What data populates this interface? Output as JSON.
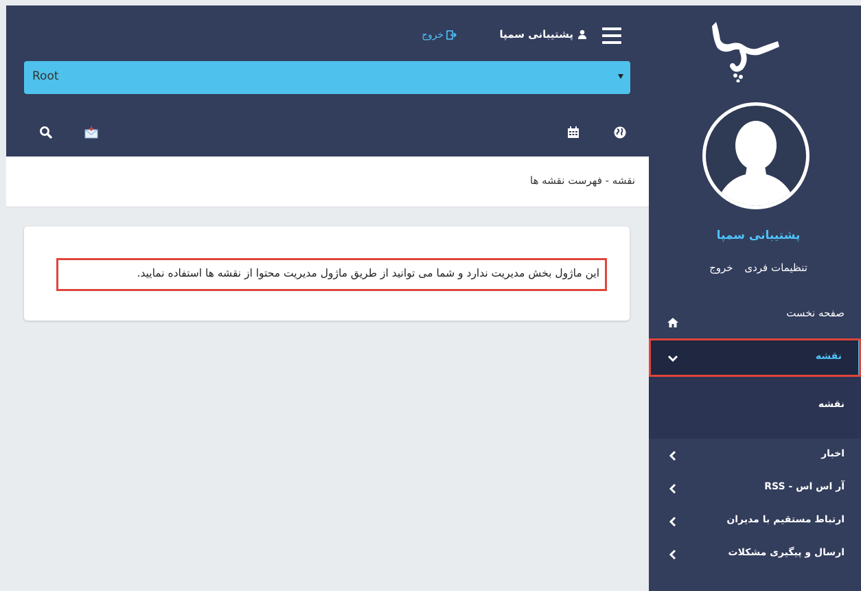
{
  "topbar": {
    "user_name": "پشتیبانی سمپا",
    "logout_label": "خروج",
    "root_select_value": "Root"
  },
  "breadcrumb": {
    "text": "نقشه - فهرست نقشه ها"
  },
  "content": {
    "notice_text": "این ماژول بخش مدیریت ندارد و شما می توانید از طریق ماژول مدیریت محتوا از نقشه ها استفاده نمایید."
  },
  "sidebar": {
    "user_name": "پشتیبانی سمپا",
    "settings_label": "تنظیمات فردی",
    "logout_label": "خروج",
    "menu": {
      "home": "صفحه نخست",
      "map": "نقشه",
      "map_sub": "نقشه",
      "news": "اخبار",
      "rss": "آر اس اس - RSS",
      "managers": "ارتباط مستقیم با مدیران",
      "issues": "ارسال و پیگیری مشکلات"
    }
  },
  "colors": {
    "navy": "#333d5c",
    "accent_blue": "#4fc3f7",
    "select_bg": "#4ec2ec",
    "highlight_red": "#e0453a",
    "page_bg": "#e9ecef"
  },
  "icons": [
    "hamburger-icon",
    "user-icon",
    "logout-icon",
    "globe-icon",
    "calendar-icon",
    "mail-icon",
    "search-icon",
    "home-icon",
    "chevron-down-icon",
    "chevron-left-icon"
  ]
}
